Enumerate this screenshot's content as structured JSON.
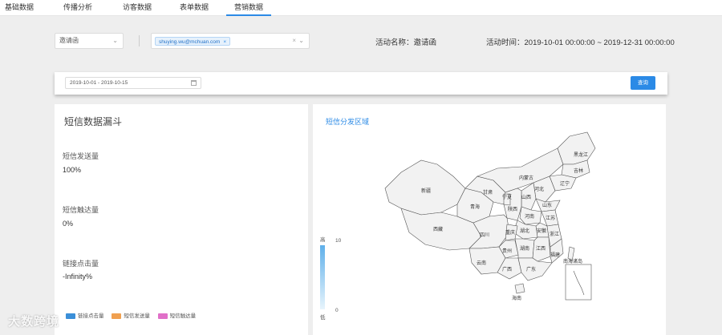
{
  "tabs": [
    {
      "label": "基础数据",
      "active": false
    },
    {
      "label": "传播分析",
      "active": false
    },
    {
      "label": "访客数据",
      "active": false
    },
    {
      "label": "表单数据",
      "active": false
    },
    {
      "label": "营销数据",
      "active": true
    }
  ],
  "filters": {
    "campaign_select": "邀请函",
    "recipient_chip": "shuying.wu@mchuan.com",
    "activity_name_label": "活动名称：邀请函",
    "activity_time_label": "活动时间：2019-10-01 00:00:00 ~ 2019-12-31 00:00:00"
  },
  "date_range": {
    "value": "2019-10-01 - 2019-10-15",
    "query_button": "查询"
  },
  "funnel": {
    "title": "短信数据漏斗",
    "metrics": [
      {
        "label": "短信发送量",
        "value": "100%"
      },
      {
        "label": "短信触达量",
        "value": "0%"
      },
      {
        "label": "链接点击量",
        "value": "-Infinity%"
      }
    ],
    "legend": [
      {
        "label": "链接点击量",
        "color": "#3b8fd8"
      },
      {
        "label": "短信发送量",
        "color": "#f0a050"
      },
      {
        "label": "短信触达量",
        "color": "#e070c8"
      }
    ]
  },
  "map": {
    "title": "短信分发区域",
    "scale_high": "高",
    "scale_low": "低",
    "scale_max": "10",
    "scale_min": "0",
    "provinces": [
      "黑龙江",
      "吉林",
      "辽宁",
      "内蒙古",
      "新疆",
      "西藏",
      "青海",
      "甘肃",
      "宁夏",
      "陕西",
      "山西",
      "河北",
      "山东",
      "河南",
      "江苏",
      "安徽",
      "湖北",
      "四川",
      "重庆",
      "贵州",
      "湖南",
      "江西",
      "浙江",
      "福建",
      "云南",
      "广西",
      "广东",
      "海南",
      "南海诸岛"
    ]
  },
  "watermark": "大数跨境",
  "colors": {
    "accent": "#2b8ae6",
    "map_fill": "#f2f2f2",
    "map_stroke": "#555555"
  }
}
